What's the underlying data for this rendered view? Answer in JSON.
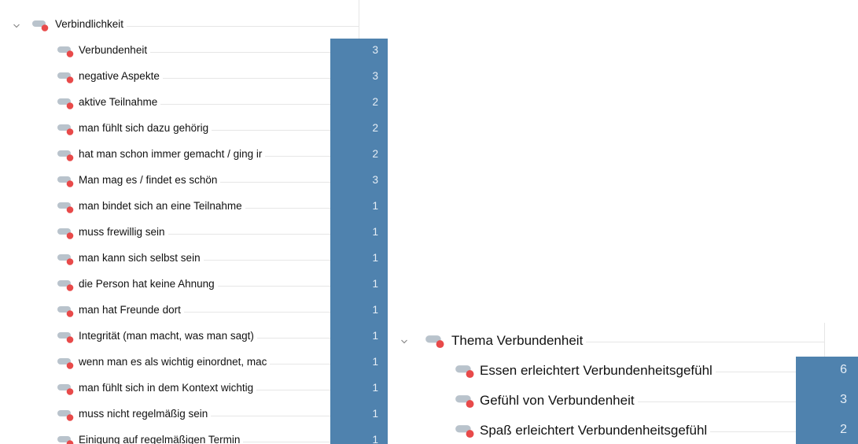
{
  "panel_top": {
    "parent": {
      "label": "Verbindlichkeit",
      "expanded": true
    },
    "children": [
      {
        "label": "Verbundenheit",
        "count": "3"
      },
      {
        "label": "negative Aspekte",
        "count": "3"
      },
      {
        "label": "aktive Teilnahme",
        "count": "2"
      },
      {
        "label": "man fühlt sich dazu gehörig",
        "count": "2"
      },
      {
        "label": "hat man schon immer gemacht / ging ir",
        "count": "2"
      },
      {
        "label": "Man mag es / findet es schön",
        "count": "3"
      },
      {
        "label": "man bindet sich an eine Teilnahme",
        "count": "1"
      },
      {
        "label": "muss frewillig sein",
        "count": "1"
      },
      {
        "label": "man kann sich selbst sein",
        "count": "1"
      },
      {
        "label": "die Person hat keine Ahnung",
        "count": "1"
      },
      {
        "label": "man hat Freunde dort",
        "count": "1"
      },
      {
        "label": "Integrität (man macht, was man sagt)",
        "count": "1"
      },
      {
        "label": "wenn man es als wichtig einordnet, mac",
        "count": "1"
      },
      {
        "label": "man fühlt sich in dem Kontext wichtig",
        "count": "1"
      },
      {
        "label": "muss nicht regelmäßig sein",
        "count": "1"
      },
      {
        "label": "Einigung auf regelmäßigen Termin",
        "count": "1"
      }
    ]
  },
  "panel_bottom": {
    "parent": {
      "label": "Thema Verbundenheit",
      "expanded": true
    },
    "children": [
      {
        "label": "Essen erleichtert Verbundenheitsgefühl",
        "count": "6"
      },
      {
        "label": "Gefühl von Verbundenheit",
        "count": "3"
      },
      {
        "label": "Spaß erleichtert Verbundenheitsgefühl",
        "count": "2"
      }
    ]
  },
  "colors": {
    "count_bg": "#4f82ae",
    "code_dot": "#e84a4a",
    "code_tag": "#b9c3cc"
  },
  "icons": {
    "twisty": "chevron-down-icon",
    "code": "code-tag-icon"
  }
}
